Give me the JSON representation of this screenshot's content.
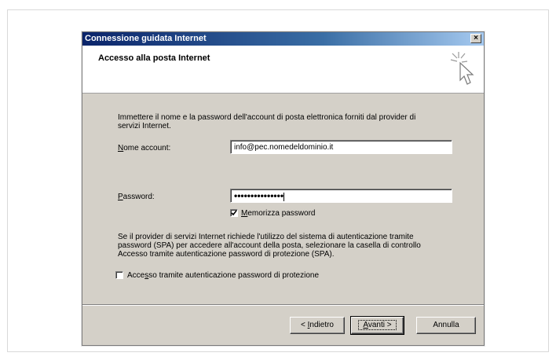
{
  "dialog": {
    "title": "Connessione guidata Internet",
    "close_glyph": "×",
    "header_title": "Accesso alla posta Internet"
  },
  "intro_text_line1": "Immettere il nome e la password dell'account di posta elettronica forniti dal provider di",
  "intro_text_line2": "servizi Internet.",
  "account": {
    "label_prefix": "N",
    "label_rest": "ome account:",
    "value": "info@pec.nomedeldominio.it"
  },
  "password": {
    "label_prefix": "P",
    "label_rest": "assword:",
    "masked_value": "•••••••••••••••"
  },
  "remember": {
    "label_prefix": "M",
    "label_rest": "emorizza password",
    "checked": true
  },
  "spa_text_line1": "Se il provider di servizi Internet richiede l'utilizzo del sistema di autenticazione tramite",
  "spa_text_line2": "password (SPA) per accedere all'account della posta, selezionare la casella di controllo",
  "spa_text_line3": "Accesso tramite autenticazione password di protezione (SPA).",
  "spa_checkbox": {
    "label_a": "Acce",
    "label_u": "s",
    "label_b": "so tramite autenticazione password di protezione",
    "checked": false
  },
  "buttons": {
    "back_a": "< ",
    "back_u": "I",
    "back_b": "ndietro",
    "next_u": "A",
    "next_b": "vanti >",
    "cancel": "Annulla"
  },
  "icons": {
    "wizard": "wizard-sparkle-cursor-icon",
    "check": "checkmark-icon"
  }
}
